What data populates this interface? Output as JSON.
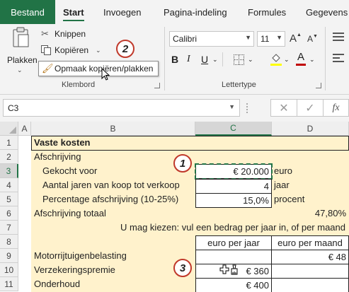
{
  "ribbon_tabs": [
    "Bestand",
    "Start",
    "Invoegen",
    "Pagina-indeling",
    "Formules",
    "Gegevens"
  ],
  "clipboard": {
    "paste_label": "Plakken",
    "cut_label": "Knippen",
    "copy_label": "Kopiëren",
    "format_painter_label": "Opmaak kopiëren/plakken",
    "group_label": "Klembord"
  },
  "font": {
    "family_value": "Calibri",
    "size_value": "11",
    "group_label": "Lettertype",
    "bold": "B",
    "italic": "I",
    "underline": "U",
    "grow": "A",
    "shrink": "A",
    "font_color": "A"
  },
  "callouts": [
    "2",
    "1",
    "3"
  ],
  "formula_bar": {
    "name_box": "C3",
    "cancel": "✕",
    "enter": "✓",
    "fx": "fx",
    "formula": ""
  },
  "columns": [
    "A",
    "B",
    "C",
    "D"
  ],
  "rows": [
    "1",
    "2",
    "3",
    "4",
    "5",
    "6",
    "7",
    "8",
    "9",
    "10",
    "11"
  ],
  "sheet": {
    "title": "Vaste kosten",
    "afschrijving": "Afschrijving",
    "gekocht_label": "Gekocht voor",
    "gekocht_value": "€ 20.000",
    "gekocht_unit": "euro",
    "jaren_label": "Aantal jaren van koop tot verkoop",
    "jaren_value": "4",
    "jaren_unit": "jaar",
    "perc_label": "Percentage afschrijving (10-25%)",
    "perc_value": "15,0%",
    "perc_unit": "procent",
    "totaal_label": "Afschrijving totaal",
    "totaal_value": "47,80%",
    "instructie": "U mag kiezen: vul een bedrag per jaar in, of per maand",
    "hdr_jaar": "euro per jaar",
    "hdr_maand": "euro per maand",
    "motor_label": "Motorrijtuigenbelasting",
    "motor_maand": "€ 48",
    "verz_label": "Verzekeringspremie",
    "verz_jaar": "€ 360",
    "onder_label": "Onderhoud",
    "onder_jaar": "€ 400"
  },
  "colors": {
    "accent": "#217346",
    "sheet_fill": "#fff2cc",
    "callout_ring": "#c0392b",
    "font_color_bar": "#c00000"
  }
}
